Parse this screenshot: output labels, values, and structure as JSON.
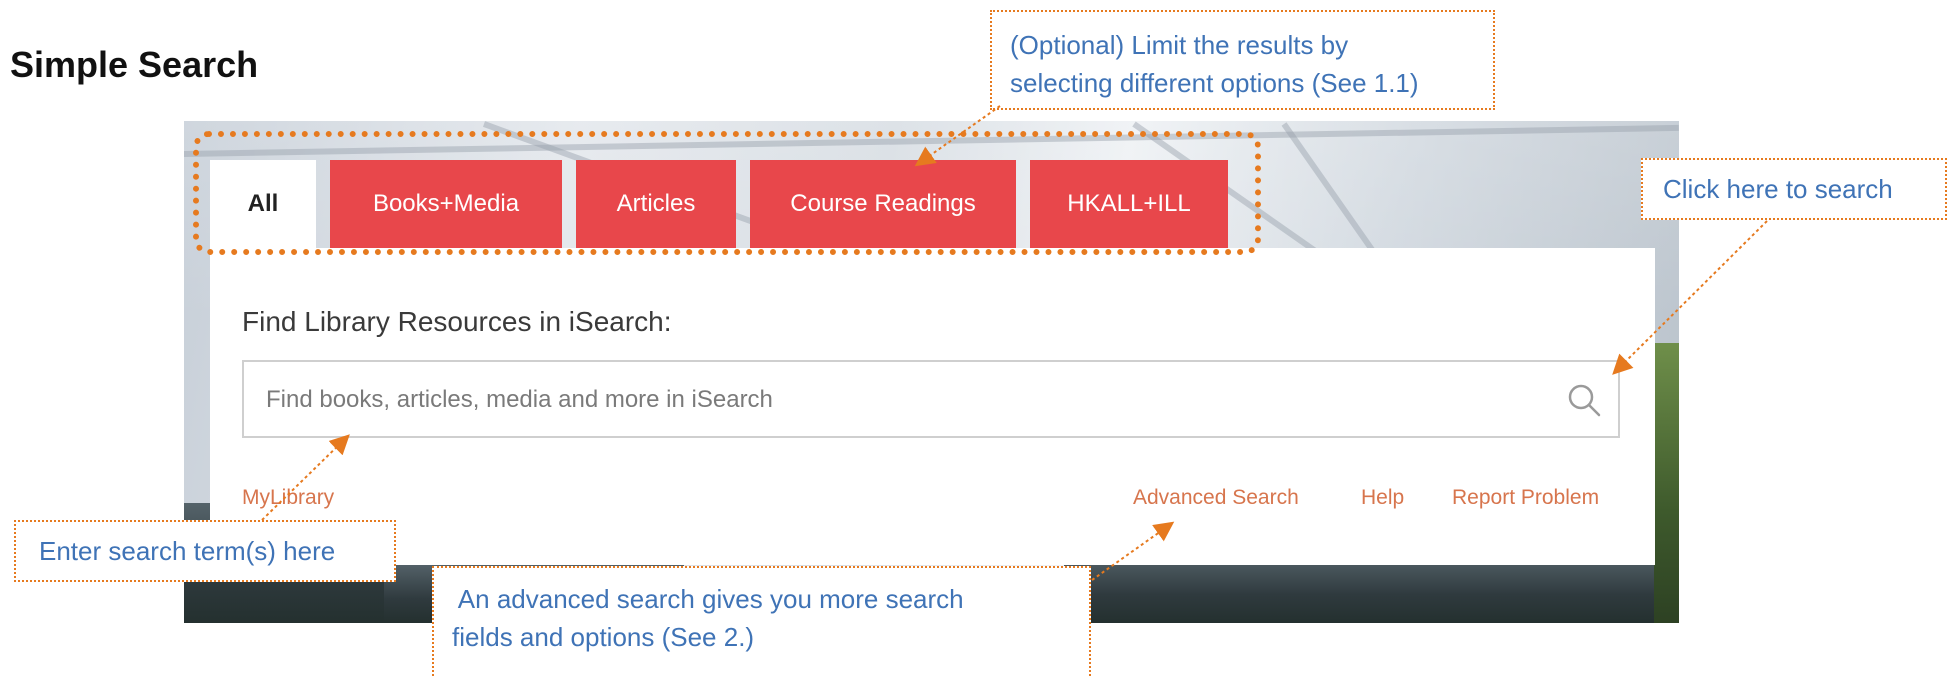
{
  "page": {
    "title": "Simple Search"
  },
  "widget": {
    "tabs": [
      {
        "label": "All"
      },
      {
        "label": "Books+Media"
      },
      {
        "label": "Articles"
      },
      {
        "label": "Course Readings"
      },
      {
        "label": "HKALL+ILL"
      }
    ],
    "heading": "Find Library Resources in iSearch:",
    "search": {
      "placeholder": "Find books, articles, media and more in iSearch",
      "value": ""
    },
    "links": {
      "mylibrary": "MyLibrary",
      "advanced": "Advanced Search",
      "help": "Help",
      "report": "Report Problem"
    }
  },
  "annotations": {
    "tabs_note": "(Optional) Limit the results by\nselecting different options (See 1.1)",
    "search_note": "Click here to search",
    "enter_note": "Enter search term(s) here",
    "advanced_note": " An advanced search gives you more search\nfields and options (See 2.)"
  },
  "colors": {
    "tab_red": "#e8474b",
    "link_orange": "#d7754d",
    "annotation_orange": "#e67a1f",
    "annotation_text_blue": "#3f73b6"
  }
}
